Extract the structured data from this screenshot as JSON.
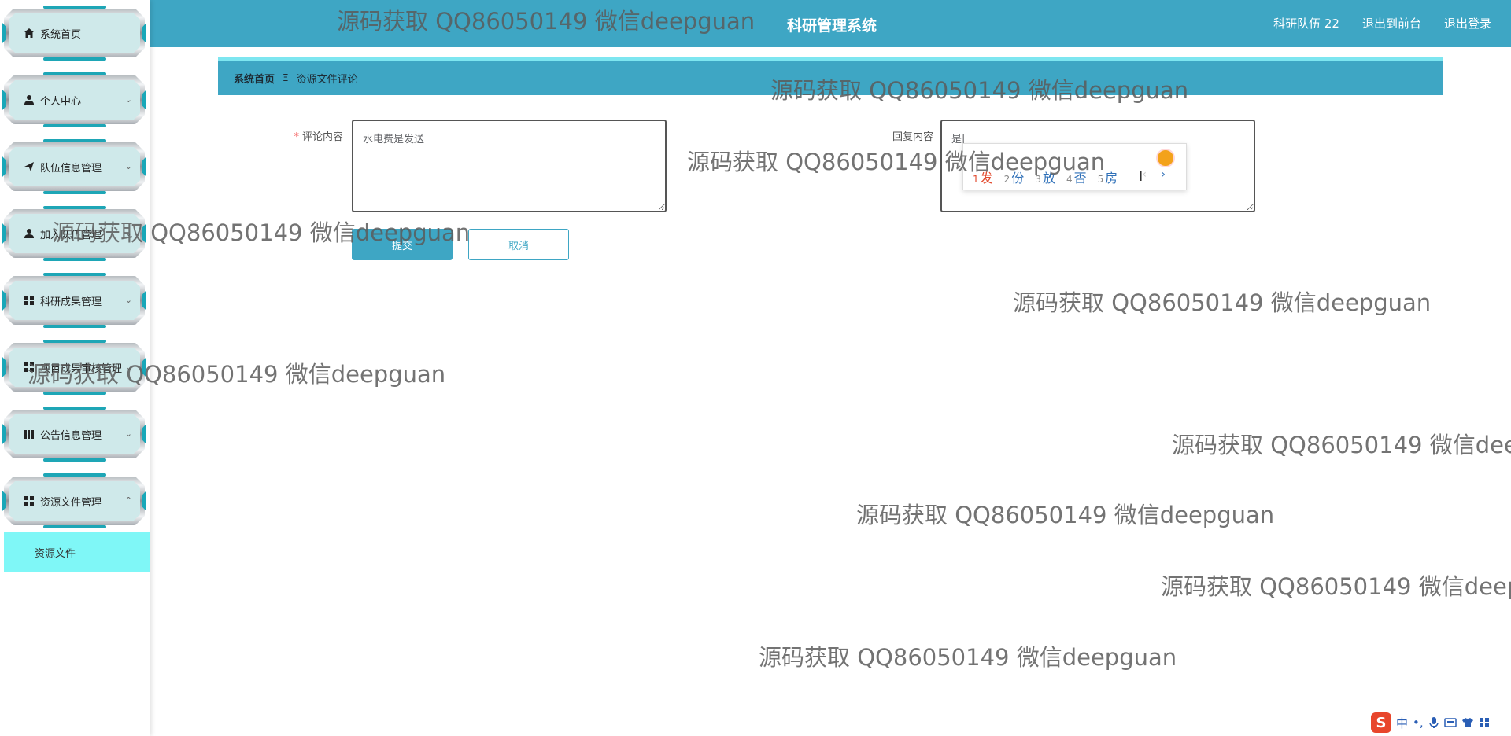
{
  "sidebar": {
    "items": [
      {
        "label": "系统首页",
        "icon": "home-icon",
        "chevron": ""
      },
      {
        "label": "个人中心",
        "icon": "user-icon",
        "chevron": "⌄"
      },
      {
        "label": "队伍信息管理",
        "icon": "send-icon",
        "chevron": "⌄"
      },
      {
        "label": "加入队伍管理",
        "icon": "user-icon",
        "chevron": "⌄"
      },
      {
        "label": "科研成果管理",
        "icon": "grid-icon",
        "chevron": "⌄"
      },
      {
        "label": "项目成果审核管理",
        "icon": "grid-icon",
        "chevron": "⌄"
      },
      {
        "label": "公告信息管理",
        "icon": "book-icon",
        "chevron": "⌄"
      },
      {
        "label": "资源文件管理",
        "icon": "grid-icon",
        "chevron": "^"
      }
    ],
    "submenu": {
      "label": "资源文件"
    }
  },
  "header": {
    "title": "科研管理系统",
    "user": "科研队伍 22",
    "front": "退出到前台",
    "logout": "退出登录"
  },
  "breadcrumb": {
    "home": "系统首页",
    "separator": "Ξ",
    "current": "资源文件评论"
  },
  "form": {
    "comment_label": "评论内容",
    "required_mark": "*",
    "comment_value": "水电费是发送",
    "reply_label": "回复内容",
    "reply_value": "是|",
    "submit": "提交",
    "cancel": "取消"
  },
  "ime": {
    "candidates": [
      {
        "num": "1",
        "text": "发"
      },
      {
        "num": "2",
        "text": "份"
      },
      {
        "num": "3",
        "text": "放"
      },
      {
        "num": "4",
        "text": "否"
      },
      {
        "num": "5",
        "text": "房"
      }
    ],
    "prev": "‹",
    "next": "›"
  },
  "watermark": "源码获取 QQ86050149 微信deepguan",
  "tray": {
    "logo": "S",
    "lang": "中",
    "punct": "•,",
    "icons": [
      "mic-icon",
      "keyboard-icon",
      "shirt-icon",
      "apps-icon"
    ]
  },
  "colors": {
    "primary": "#3ea6c4",
    "submenu_bg": "#7ff7f7",
    "required": "#f56c6c"
  }
}
